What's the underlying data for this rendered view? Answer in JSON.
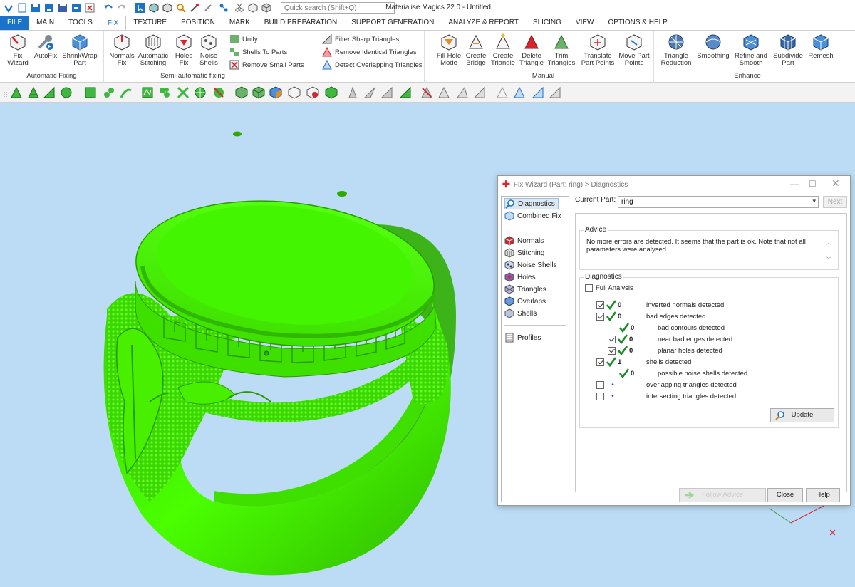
{
  "app": {
    "title": "Materialise Magics 22.0 - Untitled",
    "quick_search_placeholder": "Quick search (Shift+Q)"
  },
  "tabs": [
    "FILE",
    "MAIN",
    "TOOLS",
    "FIX",
    "TEXTURE",
    "POSITION",
    "MARK",
    "BUILD PREPARATION",
    "SUPPORT GENERATION",
    "ANALYZE & REPORT",
    "SLICING",
    "VIEW",
    "OPTIONS & HELP"
  ],
  "active_tab": "FIX",
  "ribbon": {
    "automatic_fixing": {
      "title": "Automatic Fixing",
      "buttons": [
        {
          "line1": "Fix",
          "line2": "Wizard"
        },
        {
          "line1": "AutoFix",
          "line2": ""
        },
        {
          "line1": "ShrinkWrap",
          "line2": "Part"
        }
      ]
    },
    "semi_automatic": {
      "title": "Semi-automatic fixing",
      "buttons": [
        {
          "line1": "Normals",
          "line2": "Fix"
        },
        {
          "line1": "Automatic",
          "line2": "Stitching"
        },
        {
          "line1": "Holes",
          "line2": "Fix"
        },
        {
          "line1": "Noise",
          "line2": "Shells"
        }
      ],
      "small": [
        "Unify",
        "Shells To Parts",
        "Remove Small Parts"
      ],
      "filters": [
        "Filter Sharp Triangles",
        "Remove Identical Triangles",
        "Detect Overlapping Triangles"
      ]
    },
    "manual": {
      "title": "Manual",
      "buttons": [
        {
          "line1": "Fill Hole",
          "line2": "Mode"
        },
        {
          "line1": "Create",
          "line2": "Bridge"
        },
        {
          "line1": "Create",
          "line2": "Triangle"
        },
        {
          "line1": "Delete",
          "line2": "Triangle"
        },
        {
          "line1": "Trim",
          "line2": "Triangles"
        },
        {
          "line1": "Translate",
          "line2": "Part Points"
        },
        {
          "line1": "Move Part",
          "line2": "Points"
        }
      ]
    },
    "enhance": {
      "title": "Enhance",
      "buttons": [
        {
          "line1": "Triangle",
          "line2": "Reduction"
        },
        {
          "line1": "Smoothing",
          "line2": ""
        },
        {
          "line1": "Refine and",
          "line2": "Smooth"
        },
        {
          "line1": "Subdivide",
          "line2": "Part"
        },
        {
          "line1": "Remesh",
          "line2": ""
        }
      ]
    }
  },
  "dialog": {
    "title": "Fix Wizard (Part: ring) > Diagnostics",
    "nav_top": [
      "Diagnostics",
      "Combined Fix"
    ],
    "nav_mid": [
      "Normals",
      "Stitching",
      "Noise Shells",
      "Holes",
      "Triangles",
      "Overlaps",
      "Shells"
    ],
    "nav_bottom": [
      "Profiles"
    ],
    "current_part_label": "Current Part:",
    "current_part_value": "ring",
    "next_label": "Next",
    "advice_legend": "Advice",
    "advice_text": "No more errors are detected. It seems that the part is ok. Note that not all parameters were analysed.",
    "diagnostics_legend": "Diagnostics",
    "full_analysis_label": "Full Analysis",
    "rows": [
      {
        "checkbox": true,
        "checked": true,
        "status": "ok",
        "count": "0",
        "label": "inverted normals detected",
        "indent": 0
      },
      {
        "checkbox": true,
        "checked": true,
        "status": "ok",
        "count": "0",
        "label": "bad edges detected",
        "indent": 0
      },
      {
        "checkbox": false,
        "checked": false,
        "status": "ok",
        "count": "0",
        "label": "bad contours detected",
        "indent": 1
      },
      {
        "checkbox": true,
        "checked": true,
        "status": "ok",
        "count": "0",
        "label": "near bad edges detected",
        "indent": 1
      },
      {
        "checkbox": true,
        "checked": true,
        "status": "ok",
        "count": "0",
        "label": "planar holes detected",
        "indent": 1
      },
      {
        "checkbox": true,
        "checked": true,
        "status": "ok",
        "count": "1",
        "label": "shells detected",
        "indent": 0
      },
      {
        "checkbox": false,
        "checked": false,
        "status": "ok",
        "count": "0",
        "label": "possible noise shells detected",
        "indent": 1
      },
      {
        "checkbox": true,
        "checked": false,
        "status": "pending",
        "count": "",
        "label": "overlapping triangles detected",
        "indent": 0
      },
      {
        "checkbox": true,
        "checked": false,
        "status": "pending",
        "count": "",
        "label": "intersecting triangles detected",
        "indent": 0
      }
    ],
    "update_label": "Update",
    "follow_advice_label": "Follow Advice",
    "close_label": "Close",
    "help_label": "Help"
  },
  "colors": {
    "model_green": "#3fe000",
    "viewport_bg": "#bcdcf5",
    "accent_blue": "#1a73c8"
  }
}
